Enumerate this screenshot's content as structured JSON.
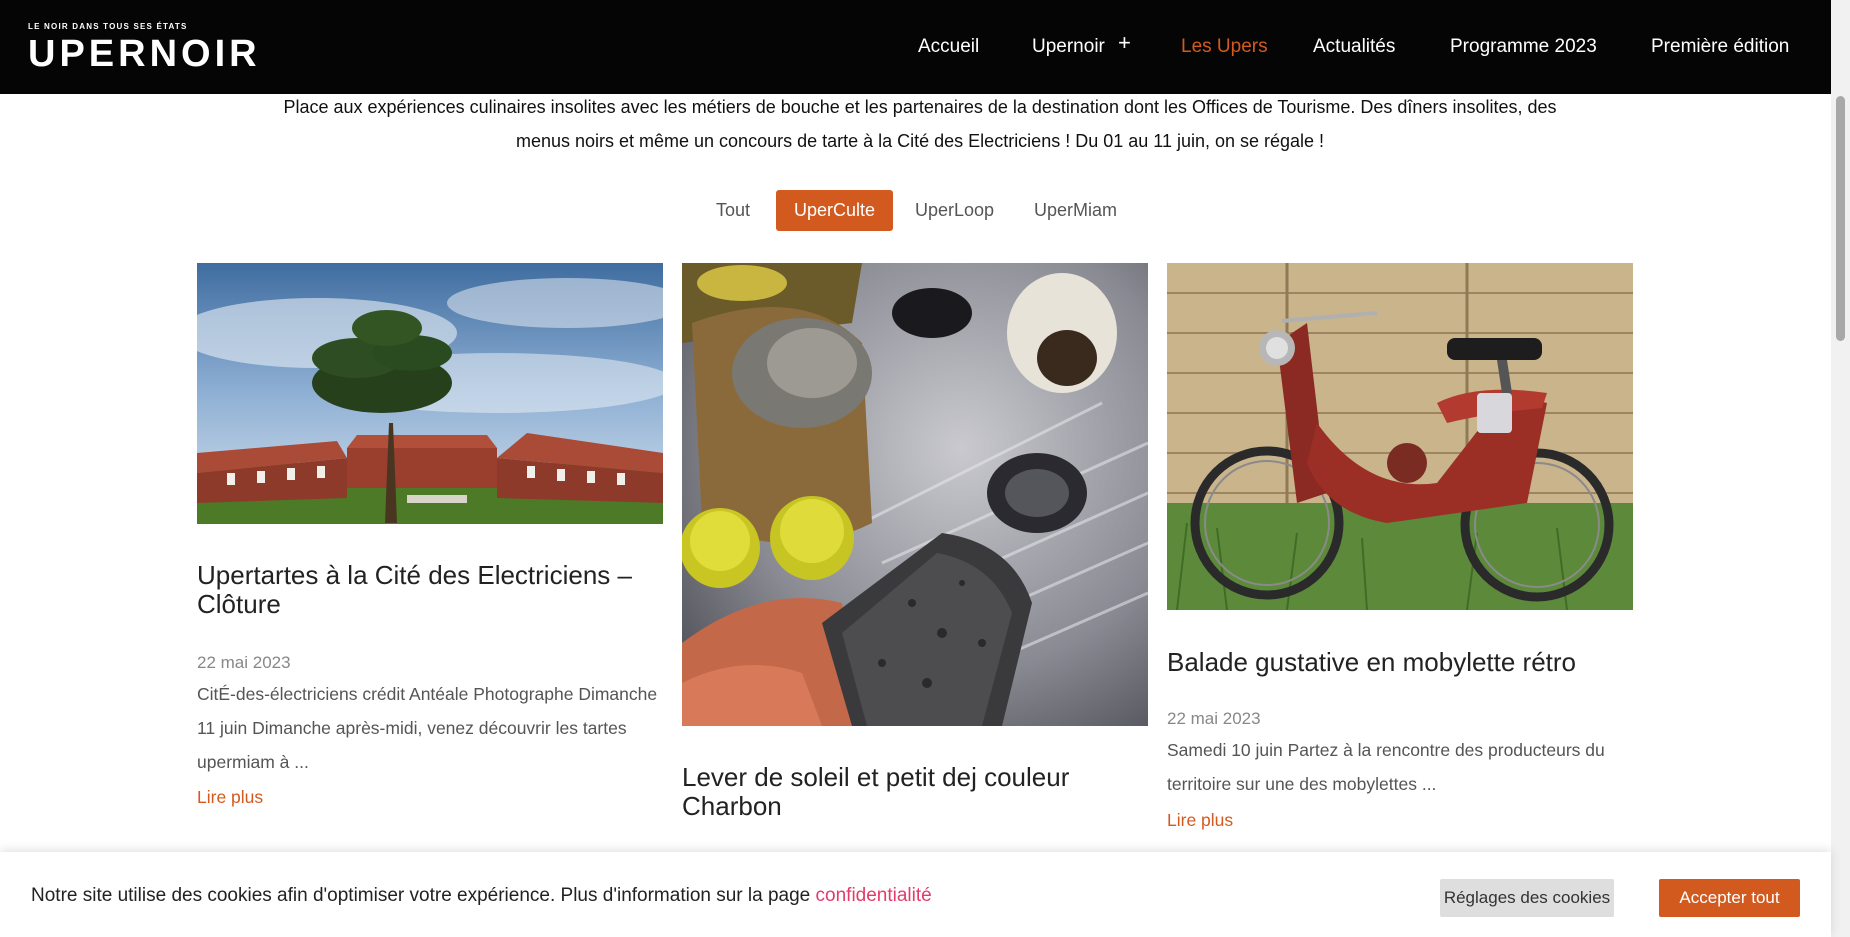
{
  "header": {
    "logo_tagline": "LE NOIR DANS TOUS SES ÉTATS",
    "logo_word": "UPERNOIR",
    "nav": [
      {
        "label": "Accueil",
        "active": false
      },
      {
        "label": "Upernoir",
        "active": false,
        "has_submenu": true
      },
      {
        "label": "Les Upers",
        "active": true
      },
      {
        "label": "Actualités",
        "active": false
      },
      {
        "label": "Programme 2023",
        "active": false
      },
      {
        "label": "Première édition",
        "active": false
      }
    ],
    "submenu_icon": "+"
  },
  "intro": {
    "line1": "Place aux expériences culinaires insolites avec les métiers de bouche et les partenaires de la destination dont les Offices de Tourisme. Des dîners insolites, des",
    "line2": "menus noirs et même un concours de tarte à la Cité des Electriciens ! Du 01 au 11 juin, on se régale !"
  },
  "filters": [
    {
      "label": "Tout",
      "active": false
    },
    {
      "label": "UperCulte",
      "active": true
    },
    {
      "label": "UperLoop",
      "active": false
    },
    {
      "label": "UperMiam",
      "active": false
    }
  ],
  "cards": [
    {
      "title": "Upertartes à la Cité des Electriciens – Clôture",
      "date": "22 mai 2023",
      "excerpt": "CitÉ-des-électriciens crédit Antéale Photographe Dimanche 11 juin Dimanche après-midi, venez découvrir les tartes upermiam à ...",
      "more": "Lire plus",
      "image": "brick-houses-photo"
    },
    {
      "title": "Lever de soleil et petit dej couleur Charbon",
      "image": "black-bread-picnic-photo"
    },
    {
      "title": "Balade gustative en mobylette rétro",
      "date": "22 mai 2023",
      "excerpt": "Samedi 10 juin Partez à la rencontre des producteurs du territoire sur une des mobylettes ...",
      "more": "Lire plus",
      "image": "vintage-moped-photo"
    }
  ],
  "cookie": {
    "text": "Notre site utilise des cookies afin d'optimiser votre expérience. Plus d'information sur la page ",
    "link": "confidentialité",
    "settings_button": "Réglages des cookies",
    "accept_button": "Accepter tout"
  },
  "colors": {
    "accent": "#d35a1f",
    "header_bg": "#050505",
    "link_pink": "#e23b6e"
  }
}
